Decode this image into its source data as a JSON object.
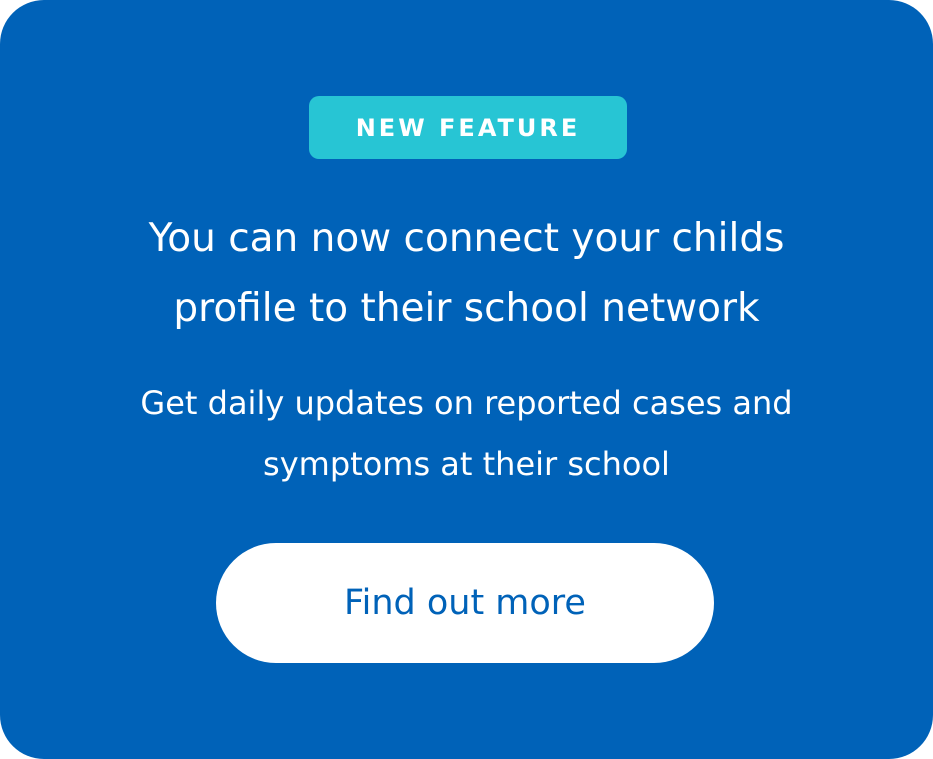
{
  "badge": {
    "label": "NEW FEATURE"
  },
  "headline": {
    "line1": "You can now connect your childs",
    "line2": "profile to their school network"
  },
  "subline": {
    "line1": "Get daily updates on reported cases and",
    "line2": "symptoms at their school"
  },
  "cta": {
    "label": "Find out more"
  },
  "colors": {
    "card_background": "#0062b8",
    "badge_background": "#27c5d4",
    "button_background": "#ffffff",
    "button_text": "#0062b8"
  }
}
